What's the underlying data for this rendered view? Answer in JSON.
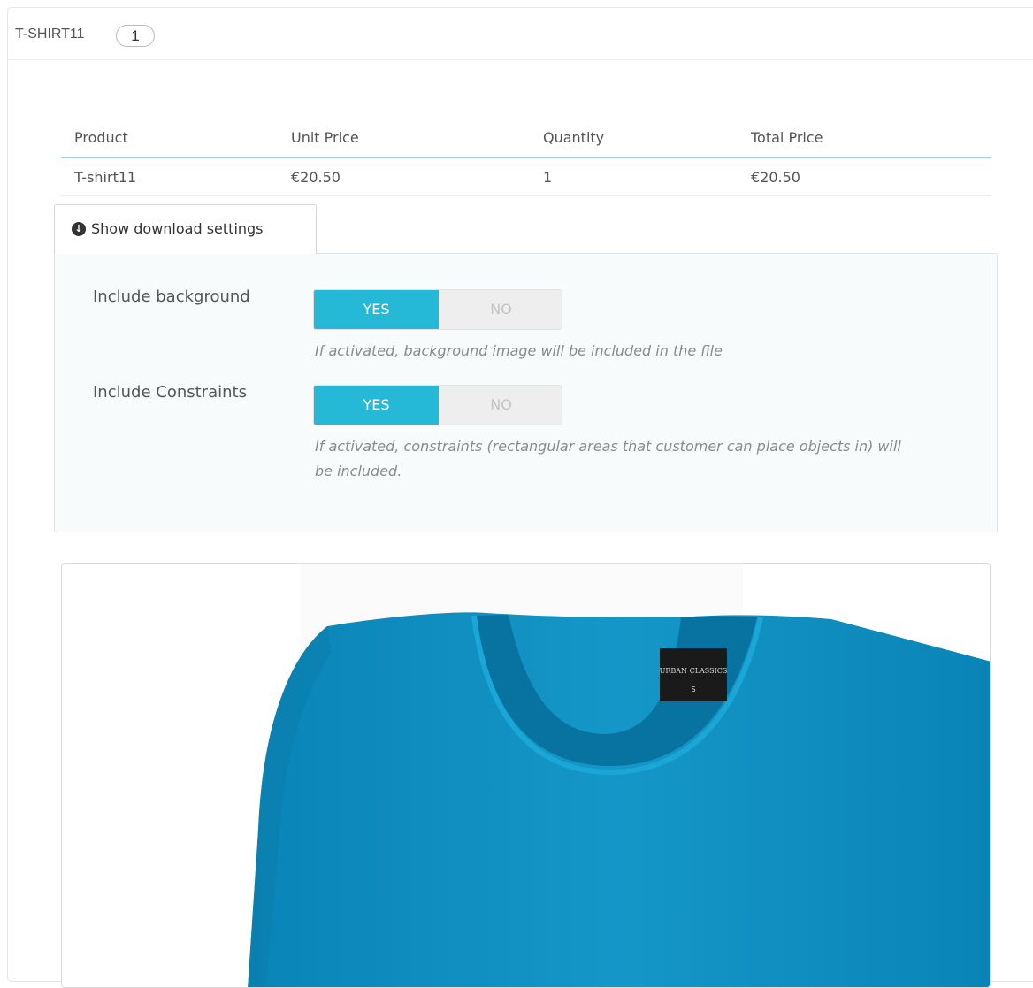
{
  "panel": {
    "title": "T-SHIRT11",
    "badge_count": "1"
  },
  "table": {
    "headers": [
      "Product",
      "Unit Price",
      "Quantity",
      "Total Price"
    ],
    "rows": [
      [
        "T-shirt11",
        "€20.50",
        "1",
        "€20.50"
      ]
    ]
  },
  "download_toggle": {
    "icon": "circle-down-arrow-icon",
    "label": "Show download settings"
  },
  "settings": [
    {
      "label": "Include background",
      "yes": "YES",
      "no": "NO",
      "selected": "YES",
      "help": "If activated, background image will be included in the file"
    },
    {
      "label": "Include Constraints",
      "yes": "YES",
      "no": "NO",
      "selected": "YES",
      "help": "If activated, constraints (rectangular areas that customer can place objects in) will be included."
    }
  ],
  "preview": {
    "image": "blue-t-shirt-product-image",
    "tag_text": [
      "URBAN CLASSICS",
      "S"
    ]
  },
  "colors": {
    "accent": "#25b9d7",
    "shirt": "#0f8dbf",
    "settings_bg": "#f8fbfc"
  }
}
